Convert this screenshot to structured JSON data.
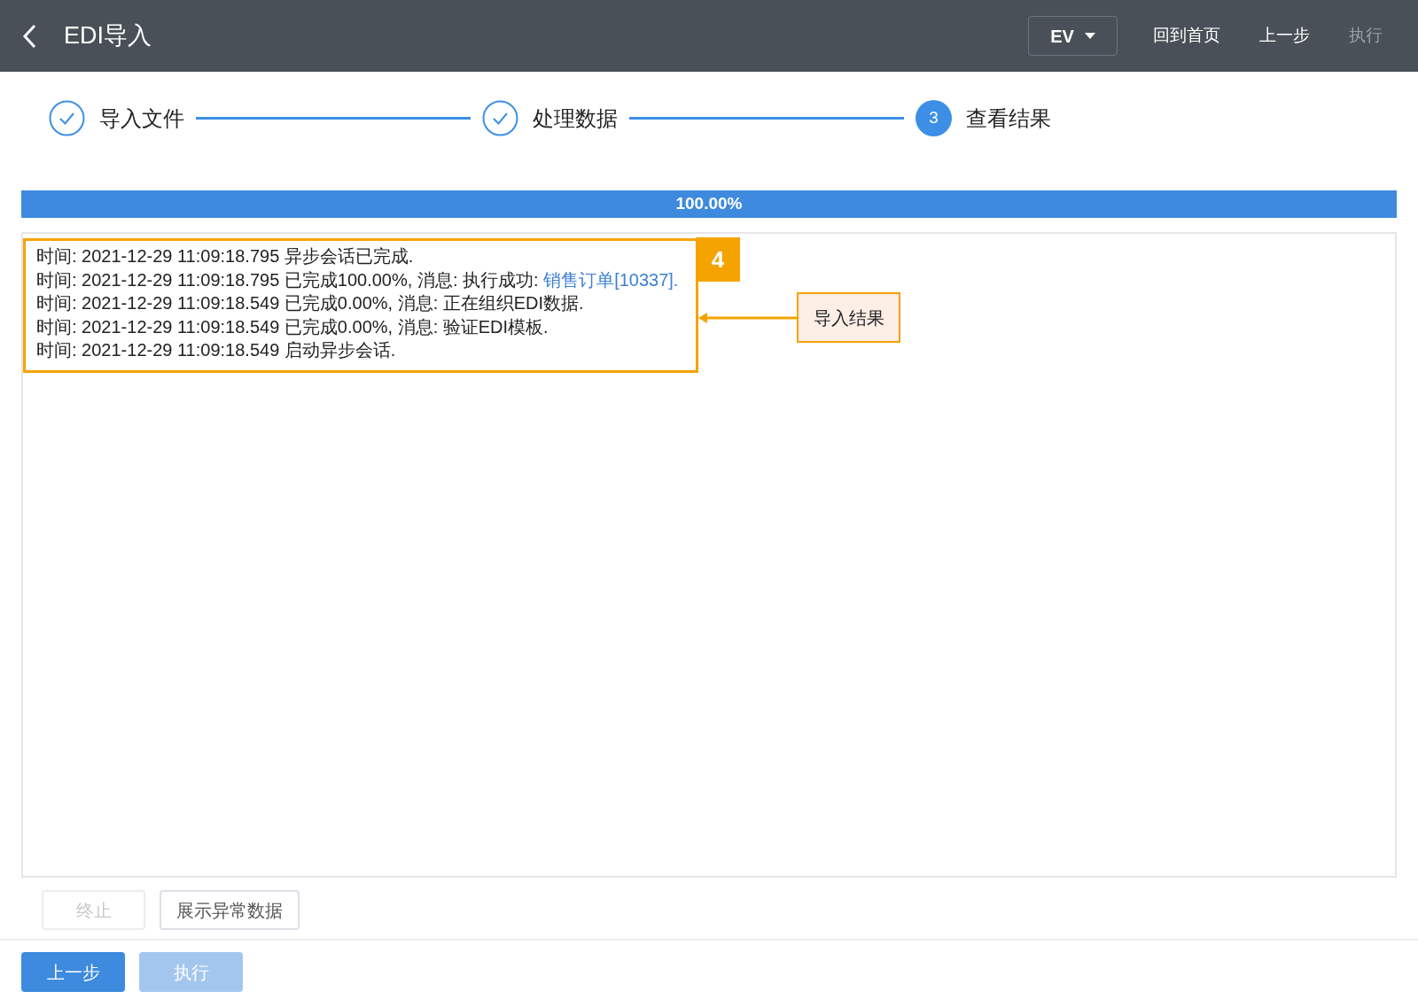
{
  "header": {
    "title": "EDI导入",
    "language": "EV",
    "actions": [
      {
        "label": "回到首页",
        "disabled": false
      },
      {
        "label": "上一步",
        "disabled": false
      },
      {
        "label": "执行",
        "disabled": true
      }
    ]
  },
  "steps": [
    {
      "label": "导入文件",
      "completed": true,
      "selected": false
    },
    {
      "label": "处理数据",
      "completed": true,
      "selected": false
    },
    {
      "label": "查看结果",
      "completed": false,
      "selected": true,
      "number": "3"
    }
  ],
  "progress": {
    "level": 1,
    "reading": "100.00%"
  },
  "log": [
    {
      "text": "时间: 2021-12-29 11:09:18.795 异步会话已完成."
    },
    {
      "text": "时间: 2021-12-29 11:09:18.795 已完成100.00%, 消息: 执行成功: ",
      "link": "销售订单[10337]."
    },
    {
      "text": "时间: 2021-12-29 11:09:18.549 已完成0.00%, 消息: 正在组织EDI数据."
    },
    {
      "text": "时间: 2021-12-29 11:09:18.549 已完成0.00%, 消息: 验证EDI模板."
    },
    {
      "text": "时间: 2021-12-29 11:09:18.549 启动异步会话."
    }
  ],
  "annotation": {
    "number": "4",
    "label": "导入结果"
  },
  "panel_buttons": [
    {
      "label": "终止",
      "disabled": true
    },
    {
      "label": "展示异常数据",
      "disabled": false
    }
  ],
  "footer_buttons": [
    {
      "label": "上一步",
      "kind": "primary",
      "disabled": false
    },
    {
      "label": "执行",
      "kind": "primary",
      "disabled": true
    }
  ]
}
